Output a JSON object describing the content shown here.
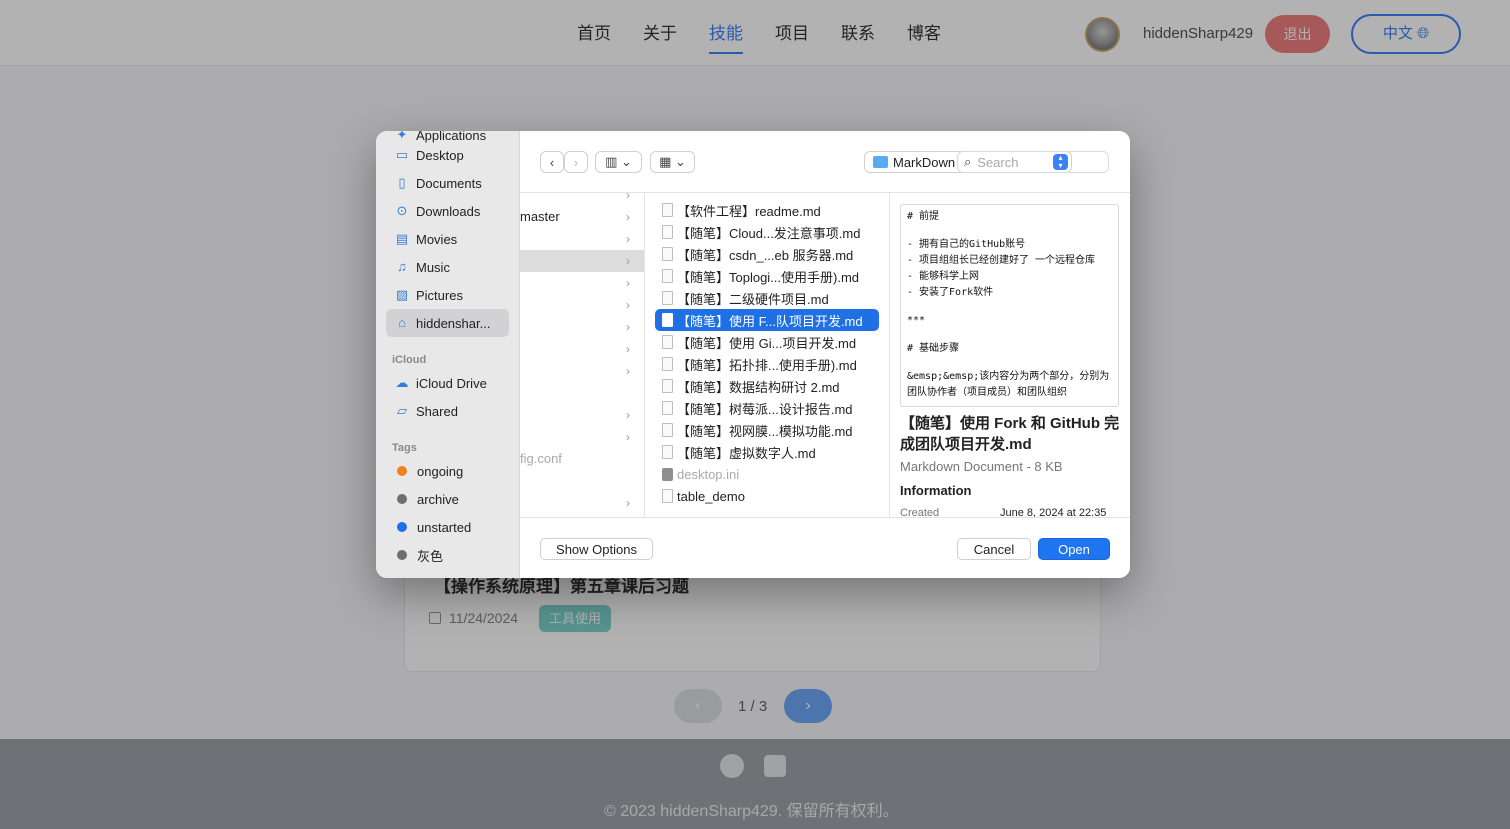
{
  "nav": {
    "items": [
      "首页",
      "关于",
      "技能",
      "项目",
      "联系",
      "博客"
    ],
    "active_index": 2
  },
  "user": {
    "name": "hiddenSharp429",
    "logout": "退出",
    "lang": "中文"
  },
  "post": {
    "title": "【操作系统原理】第五章课后习题",
    "date": "11/24/2024",
    "tag": "工具使用"
  },
  "pager": {
    "text": "1 / 3",
    "prev": "‹",
    "next": "›"
  },
  "footer": {
    "copyright": "© 2023 hiddenSharp429. 保留所有权利。"
  },
  "dialog": {
    "sidebar": {
      "favorites": [
        {
          "label": "Applications",
          "icon": "applications-icon"
        },
        {
          "label": "Desktop",
          "icon": "desktop-icon"
        },
        {
          "label": "Documents",
          "icon": "document-icon"
        },
        {
          "label": "Downloads",
          "icon": "download-icon"
        },
        {
          "label": "Movies",
          "icon": "movies-icon"
        },
        {
          "label": "Music",
          "icon": "music-icon"
        },
        {
          "label": "Pictures",
          "icon": "pictures-icon"
        },
        {
          "label": "hiddenshar...",
          "icon": "home-icon"
        }
      ],
      "icloud_heading": "iCloud",
      "icloud": [
        {
          "label": "iCloud Drive",
          "icon": "cloud-icon"
        },
        {
          "label": "Shared",
          "icon": "shared-folder-icon"
        }
      ],
      "tags_heading": "Tags",
      "tags": [
        {
          "label": "ongoing",
          "color": "#f0821e"
        },
        {
          "label": "archive",
          "color": "#6e6e6e"
        },
        {
          "label": "unstarted",
          "color": "#1f6fe5"
        },
        {
          "label": "灰色",
          "color": "#6e6e6e"
        }
      ]
    },
    "toolbar": {
      "folder": "MarkDown",
      "search_placeholder": "Search"
    },
    "column1": [
      {
        "label": "",
        "chev": "›"
      },
      {
        "label": "master",
        "chev": "›"
      },
      {
        "label": "",
        "chev": "›"
      },
      {
        "label": "",
        "chev": "›",
        "selected": true
      },
      {
        "label": "",
        "chev": "›"
      },
      {
        "label": "",
        "chev": "›"
      },
      {
        "label": "",
        "chev": "›"
      },
      {
        "label": "",
        "chev": "›"
      },
      {
        "label": "",
        "chev": "›"
      },
      {
        "label": "",
        "chev": ""
      },
      {
        "label": "",
        "chev": "›"
      },
      {
        "label": "",
        "chev": "›"
      },
      {
        "label": "fig.conf",
        "chev": "",
        "dim": true
      },
      {
        "label": "",
        "chev": ""
      },
      {
        "label": "",
        "chev": "›"
      },
      {
        "label": "",
        "chev": "›"
      }
    ],
    "files": [
      {
        "name": "【软件工程】readme.md"
      },
      {
        "name": "【随笔】Cloud...发注意事项.md"
      },
      {
        "name": "【随笔】csdn_...eb 服务器.md"
      },
      {
        "name": "【随笔】Toplogi...使用手册).md"
      },
      {
        "name": "【随笔】二级硬件项目.md"
      },
      {
        "name": "【随笔】使用 F...队项目开发.md",
        "selected": true
      },
      {
        "name": "【随笔】使用 Gi...项目开发.md"
      },
      {
        "name": "【随笔】拓扑排...使用手册).md"
      },
      {
        "name": "【随笔】数据结构研讨 2.md"
      },
      {
        "name": "【随笔】树莓派...设计报告.md"
      },
      {
        "name": "【随笔】视网膜...模拟功能.md"
      },
      {
        "name": "【随笔】虚拟数字人.md"
      },
      {
        "name": "desktop.ini",
        "dim": true,
        "kind": "gear"
      },
      {
        "name": "table_demo"
      }
    ],
    "preview": {
      "lines": [
        "# 前提",
        "",
        "- 拥有自己的GitHub账号",
        "- 项目组组长已经创建好了 一个远程仓库",
        "- 能够科学上网",
        "- 安装了Fork软件",
        "",
        "***",
        "",
        "# 基础步骤",
        "",
        "&emsp;&emsp;该内容分为两个部分，分别为团队协作者（项目成员）和团队组织"
      ],
      "title": "【随笔】使用 Fork 和 GitHub 完成团队项目开发.md",
      "kind": "Markdown Document - 8 KB",
      "info_heading": "Information",
      "created_label": "Created",
      "created_value": "June 8, 2024 at 22:35"
    },
    "buttons": {
      "show_options": "Show Options",
      "cancel": "Cancel",
      "open": "Open"
    }
  }
}
